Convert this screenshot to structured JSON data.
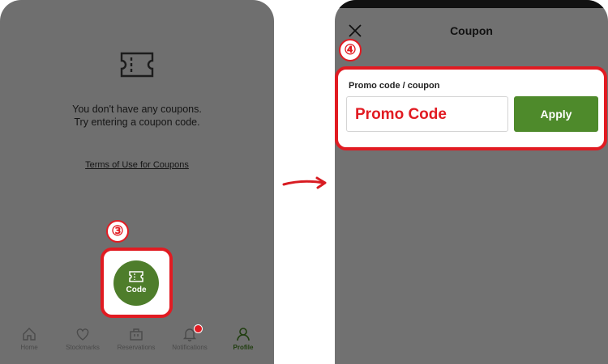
{
  "left_screen": {
    "empty_message_line1": "You don't have any coupons.",
    "empty_message_line2": "Try entering a coupon code.",
    "terms_link": "Terms of Use for Coupons",
    "step_marker": "③",
    "code_button_label": "Code",
    "nav": [
      {
        "label": "Home",
        "icon": "home-icon"
      },
      {
        "label": "Stockmarks",
        "icon": "heart-icon"
      },
      {
        "label": "Reservations",
        "icon": "briefcase-icon"
      },
      {
        "label": "Notifications",
        "icon": "bell-icon"
      },
      {
        "label": "Profile",
        "icon": "person-icon",
        "active": true
      }
    ]
  },
  "right_screen": {
    "title": "Coupon",
    "step_marker": "④",
    "promo_label": "Promo code / coupon",
    "promo_input_value": "Promo Code",
    "apply_label": "Apply"
  },
  "colors": {
    "highlight": "#e11b22",
    "accent_green": "#4e8a2b",
    "dim_overlay": "#6f6f6f"
  }
}
